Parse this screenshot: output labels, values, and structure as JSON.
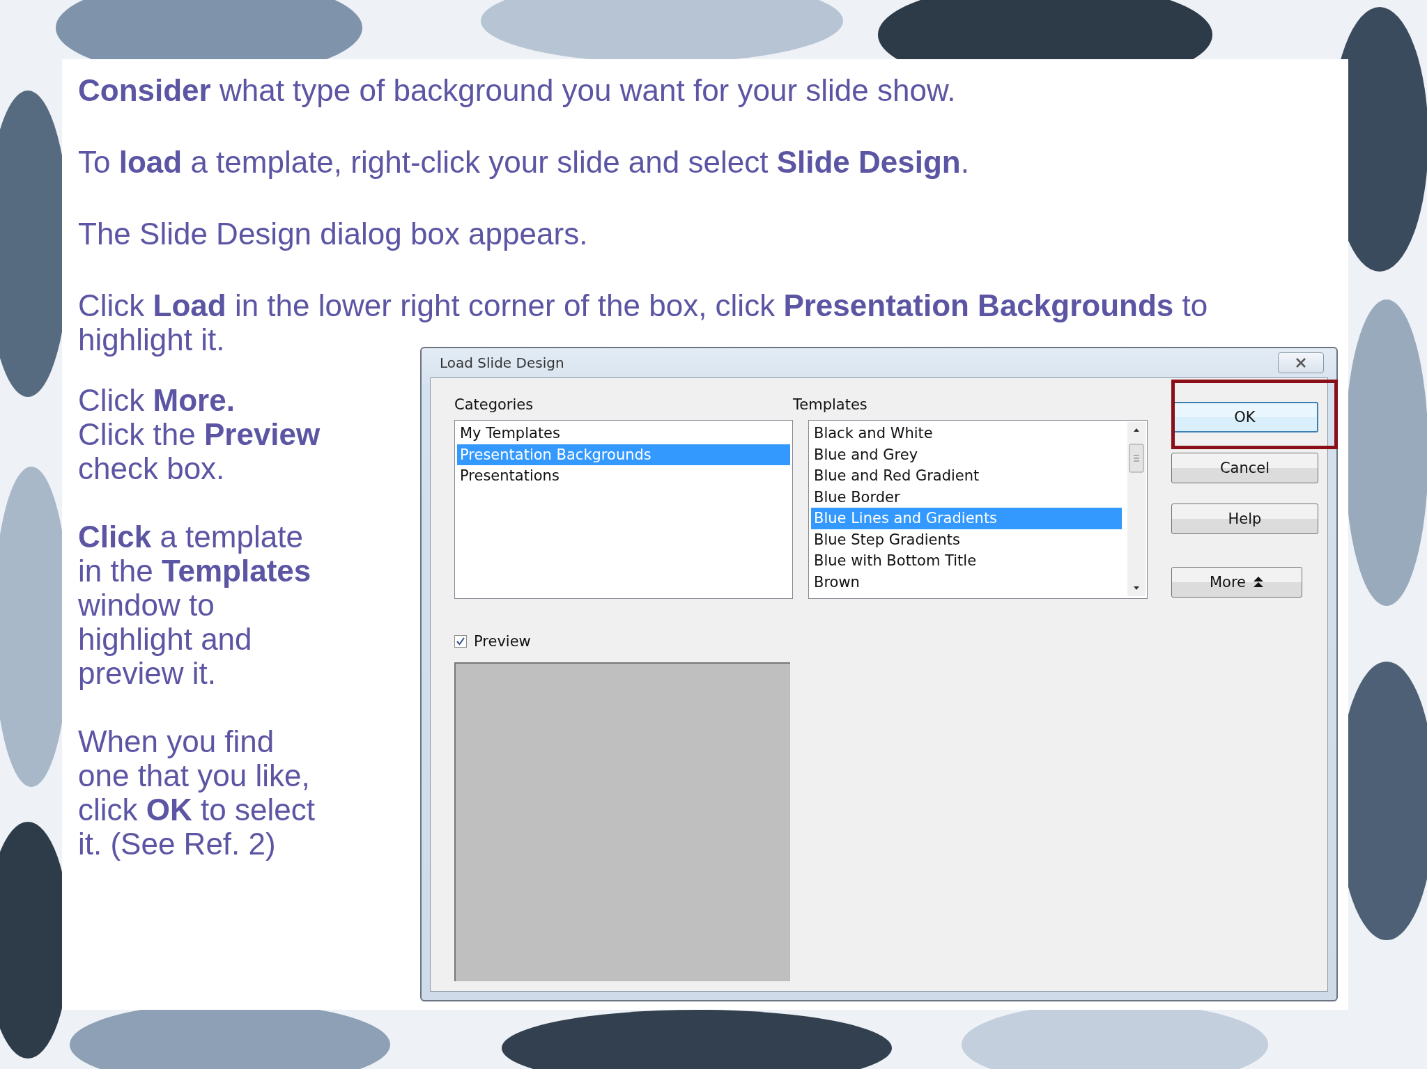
{
  "slide": {
    "paragraphs": [
      "**Consider** what type of background you want for your slide show.",
      "To **load** a template, right-click your slide and select **Slide Design**.",
      "The Slide Design dialog box appears.",
      "Click **Load** in the lower right corner of the box, click **Presentation Backgrounds** to highlight it."
    ],
    "side_paragraphs": [
      "Click **More.**\nClick the **Preview**\ncheck box.",
      "**Click** a template\nin the **Templates**\nwindow to\nhighlight and\npreview it.",
      "When you find\none that you like,\nclick **OK** to select\nit. (See Ref. 2)"
    ]
  },
  "dialog": {
    "title": "Load Slide Design",
    "categories": {
      "label": "Categories",
      "items": [
        {
          "label": "My Templates",
          "selected": false
        },
        {
          "label": "Presentation Backgrounds",
          "selected": true
        },
        {
          "label": "Presentations",
          "selected": false
        }
      ]
    },
    "templates": {
      "label": "Templates",
      "items": [
        {
          "label": "Black and White",
          "selected": false
        },
        {
          "label": "Blue and Grey",
          "selected": false
        },
        {
          "label": "Blue and Red Gradient",
          "selected": false
        },
        {
          "label": "Blue Border",
          "selected": false
        },
        {
          "label": "Blue Lines and Gradients",
          "selected": true
        },
        {
          "label": "Blue Step Gradients",
          "selected": false
        },
        {
          "label": "Blue with Bottom Title",
          "selected": false
        },
        {
          "label": "Brown",
          "selected": false
        }
      ]
    },
    "preview": {
      "label": "Preview",
      "checked": true
    },
    "buttons": [
      {
        "label": "OK",
        "kind": "default"
      },
      {
        "label": "Cancel",
        "kind": "plain"
      },
      {
        "label": "Help",
        "kind": "plain"
      },
      {
        "label": "More",
        "kind": "expander"
      }
    ]
  }
}
